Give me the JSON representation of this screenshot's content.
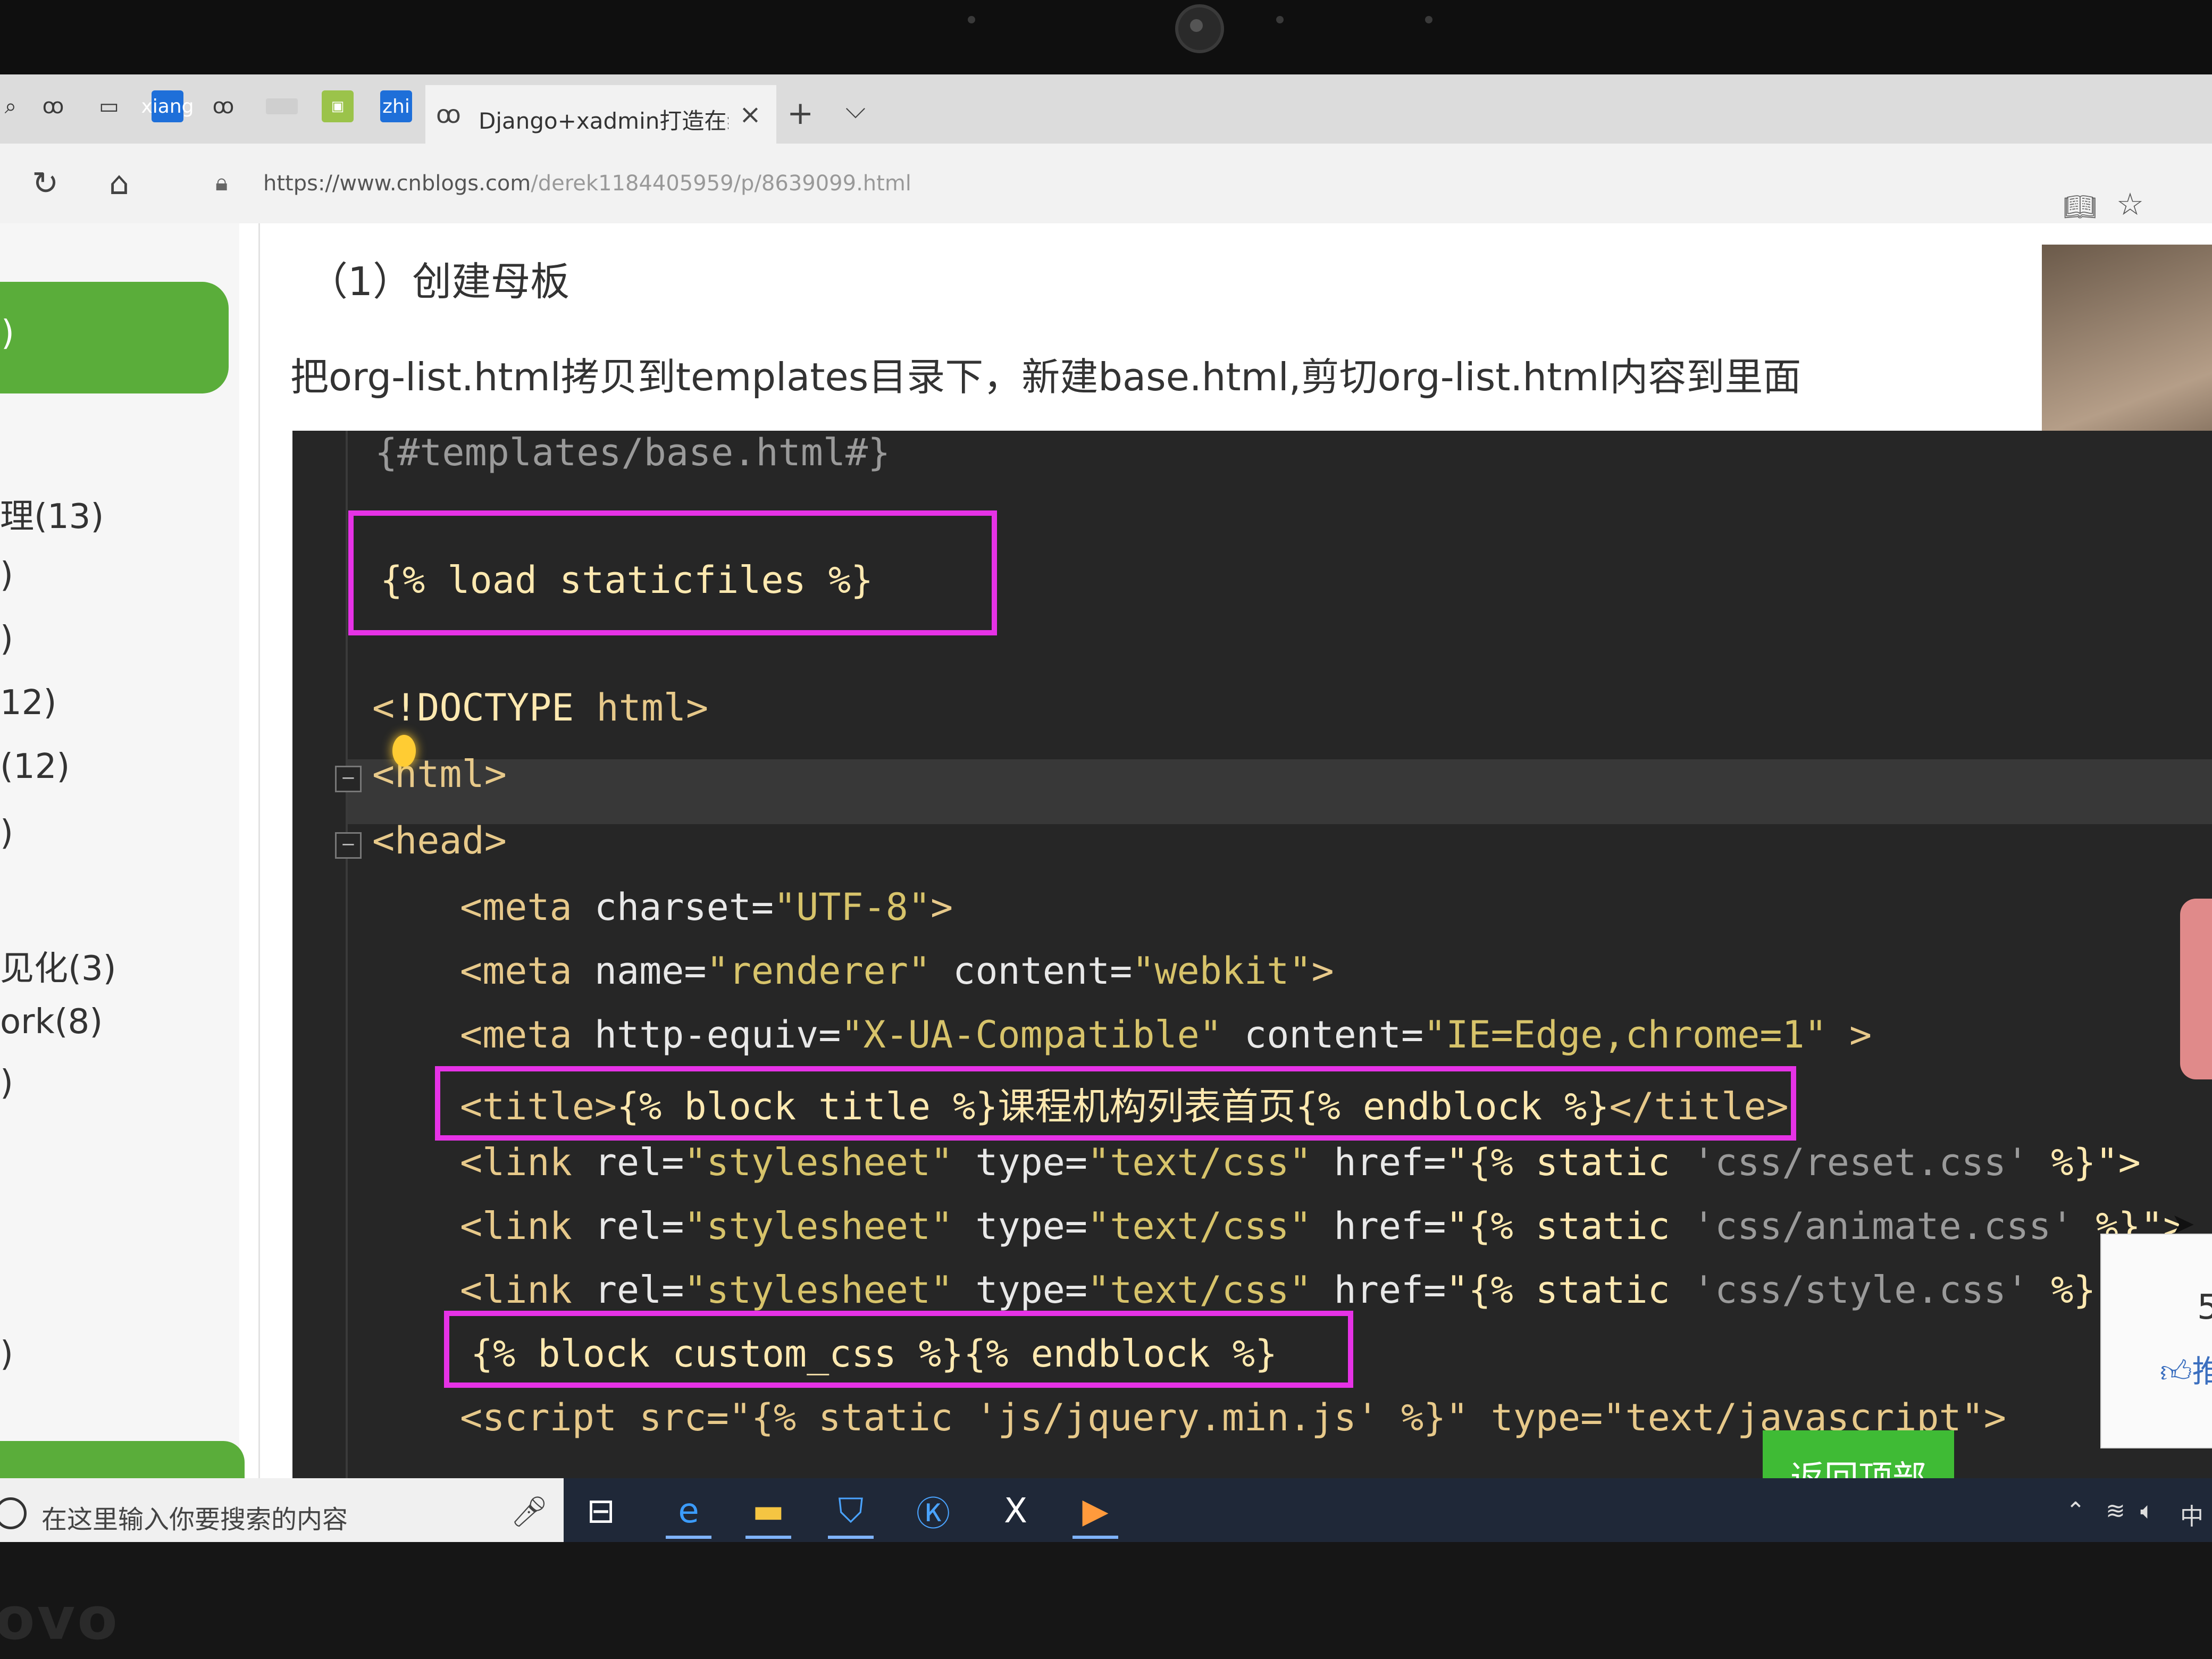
{
  "browser": {
    "tab_icons": [
      "browser-icon",
      "window-icon",
      "xiang",
      "browser-icon",
      "blank-icon",
      "image-icon",
      "zhi"
    ],
    "active_tab": {
      "title": "Django+xadmin打造在线",
      "close": "×"
    },
    "new_tab": "+",
    "tab_menu": "⌵",
    "url_host": "https://www.cnblogs.com",
    "url_path": "/derek1184405959/p/8639099.html"
  },
  "sidebar": {
    "pill_text": ")",
    "items": [
      "理(13)",
      ")",
      ")",
      "12)",
      "(12)",
      ")",
      "见化(3)",
      "ork(8)",
      ")",
      ")"
    ]
  },
  "article": {
    "heading": "（1）创建母板",
    "paragraph": "把org-list.html拷贝到templates目录下，新建base.html,剪切org-list.html内容到里面"
  },
  "code": {
    "line1": "{#templates/base.html#}",
    "line2": "{% load staticfiles %}",
    "l3_open": "<",
    "l3_doctype": "!DOCTYPE",
    "l3_html": " html>",
    "l4": "<html>",
    "l5": "<head>",
    "l6_tag": "<meta",
    "l6_attr": " charset=",
    "l6_val": "\"UTF-8\"",
    "l6_end": ">",
    "l7_tag": "<meta",
    "l7_attr1": " name=",
    "l7_val1": "\"renderer\"",
    "l7_attr2": " content=",
    "l7_val2": "\"webkit\"",
    "l7_end": ">",
    "l8_tag": "<meta",
    "l8_attr1": " http-equiv=",
    "l8_val1": "\"X-UA-Compatible\"",
    "l8_attr2": " content=",
    "l8_val2": "\"IE=Edge,chrome=1\"",
    "l8_end": " >",
    "l9_open": "<title>",
    "l9_mid": "{% block title %}课程机构列表首页{% endblock %}",
    "l9_close": "</title>",
    "link_tag": "<link",
    "link_rel": " rel=",
    "link_rel_val": "\"stylesheet\"",
    "link_type": " type=",
    "link_type_val": "\"text/css\"",
    "link_href": " href=",
    "link_static": "\"{% static",
    "l10_path": " 'css/reset.css'",
    "l11_path": " 'css/animate.css'",
    "l12_path": " 'css/style.css'",
    "link_end": " %}\">",
    "l13": "{% block custom_css %}{% endblock %}",
    "l14": "<script src=\"{% static 'js/jquery.min.js' %}\" type=\"text/javascript\">"
  },
  "buttons": {
    "back_to_top": "返回顶部"
  },
  "float_panel": {
    "number": "5",
    "label": "推"
  },
  "taskbar": {
    "search_placeholder": "在这里输入你要搜索的内容",
    "icons": [
      "task-view-icon",
      "edge-icon",
      "file-explorer-icon",
      "security-shield-icon",
      "k-app-icon",
      "excel-icon",
      "photos-icon"
    ],
    "tray_ime": "中"
  },
  "colors": {
    "highlight_box": "#e632e6",
    "green_accent": "#3fbb35",
    "code_bg": "#262626"
  }
}
